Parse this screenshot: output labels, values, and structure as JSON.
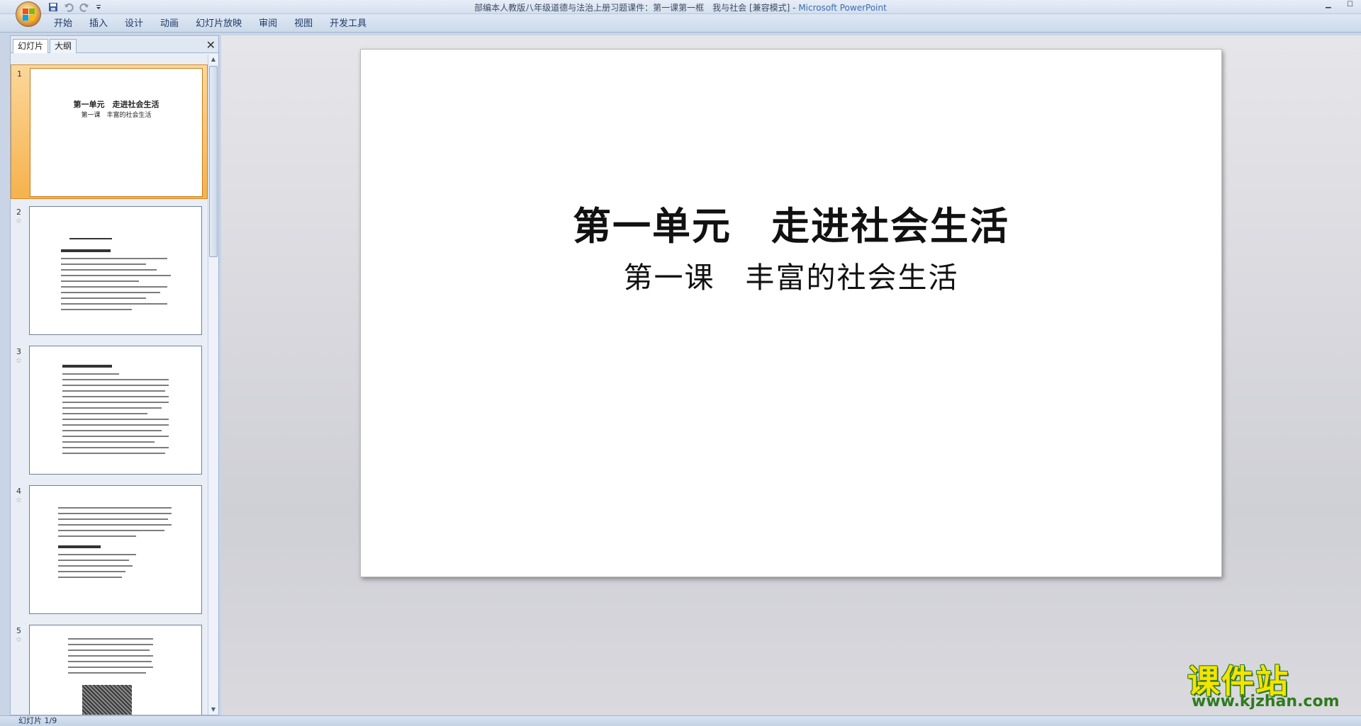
{
  "window": {
    "title": "部编本人教版八年级道德与法治上册习题课件：第一课第一框　我与社会 [兼容模式]",
    "app_name": "Microsoft PowerPoint",
    "separator": " - "
  },
  "ribbon": {
    "tabs": [
      "开始",
      "插入",
      "设计",
      "动画",
      "幻灯片放映",
      "审阅",
      "视图",
      "开发工具"
    ]
  },
  "left_pane": {
    "tab_slides": "幻灯片",
    "tab_outline": "大纲",
    "close": "✕",
    "thumbnails": [
      {
        "num": "1",
        "title": "第一单元　走进社会生活",
        "subtitle": "第一课　丰富的社会生活",
        "selected": true
      },
      {
        "num": "2",
        "selected": false
      },
      {
        "num": "3",
        "selected": false
      },
      {
        "num": "4",
        "selected": false
      },
      {
        "num": "5",
        "selected": false
      }
    ]
  },
  "slide": {
    "title": "第一单元　走进社会生活",
    "subtitle": "第一课　丰富的社会生活"
  },
  "watermark": {
    "main": "课件站",
    "url": "www.kjzhan.com"
  },
  "status": {
    "slide_indicator": "幻灯片 1/9"
  }
}
